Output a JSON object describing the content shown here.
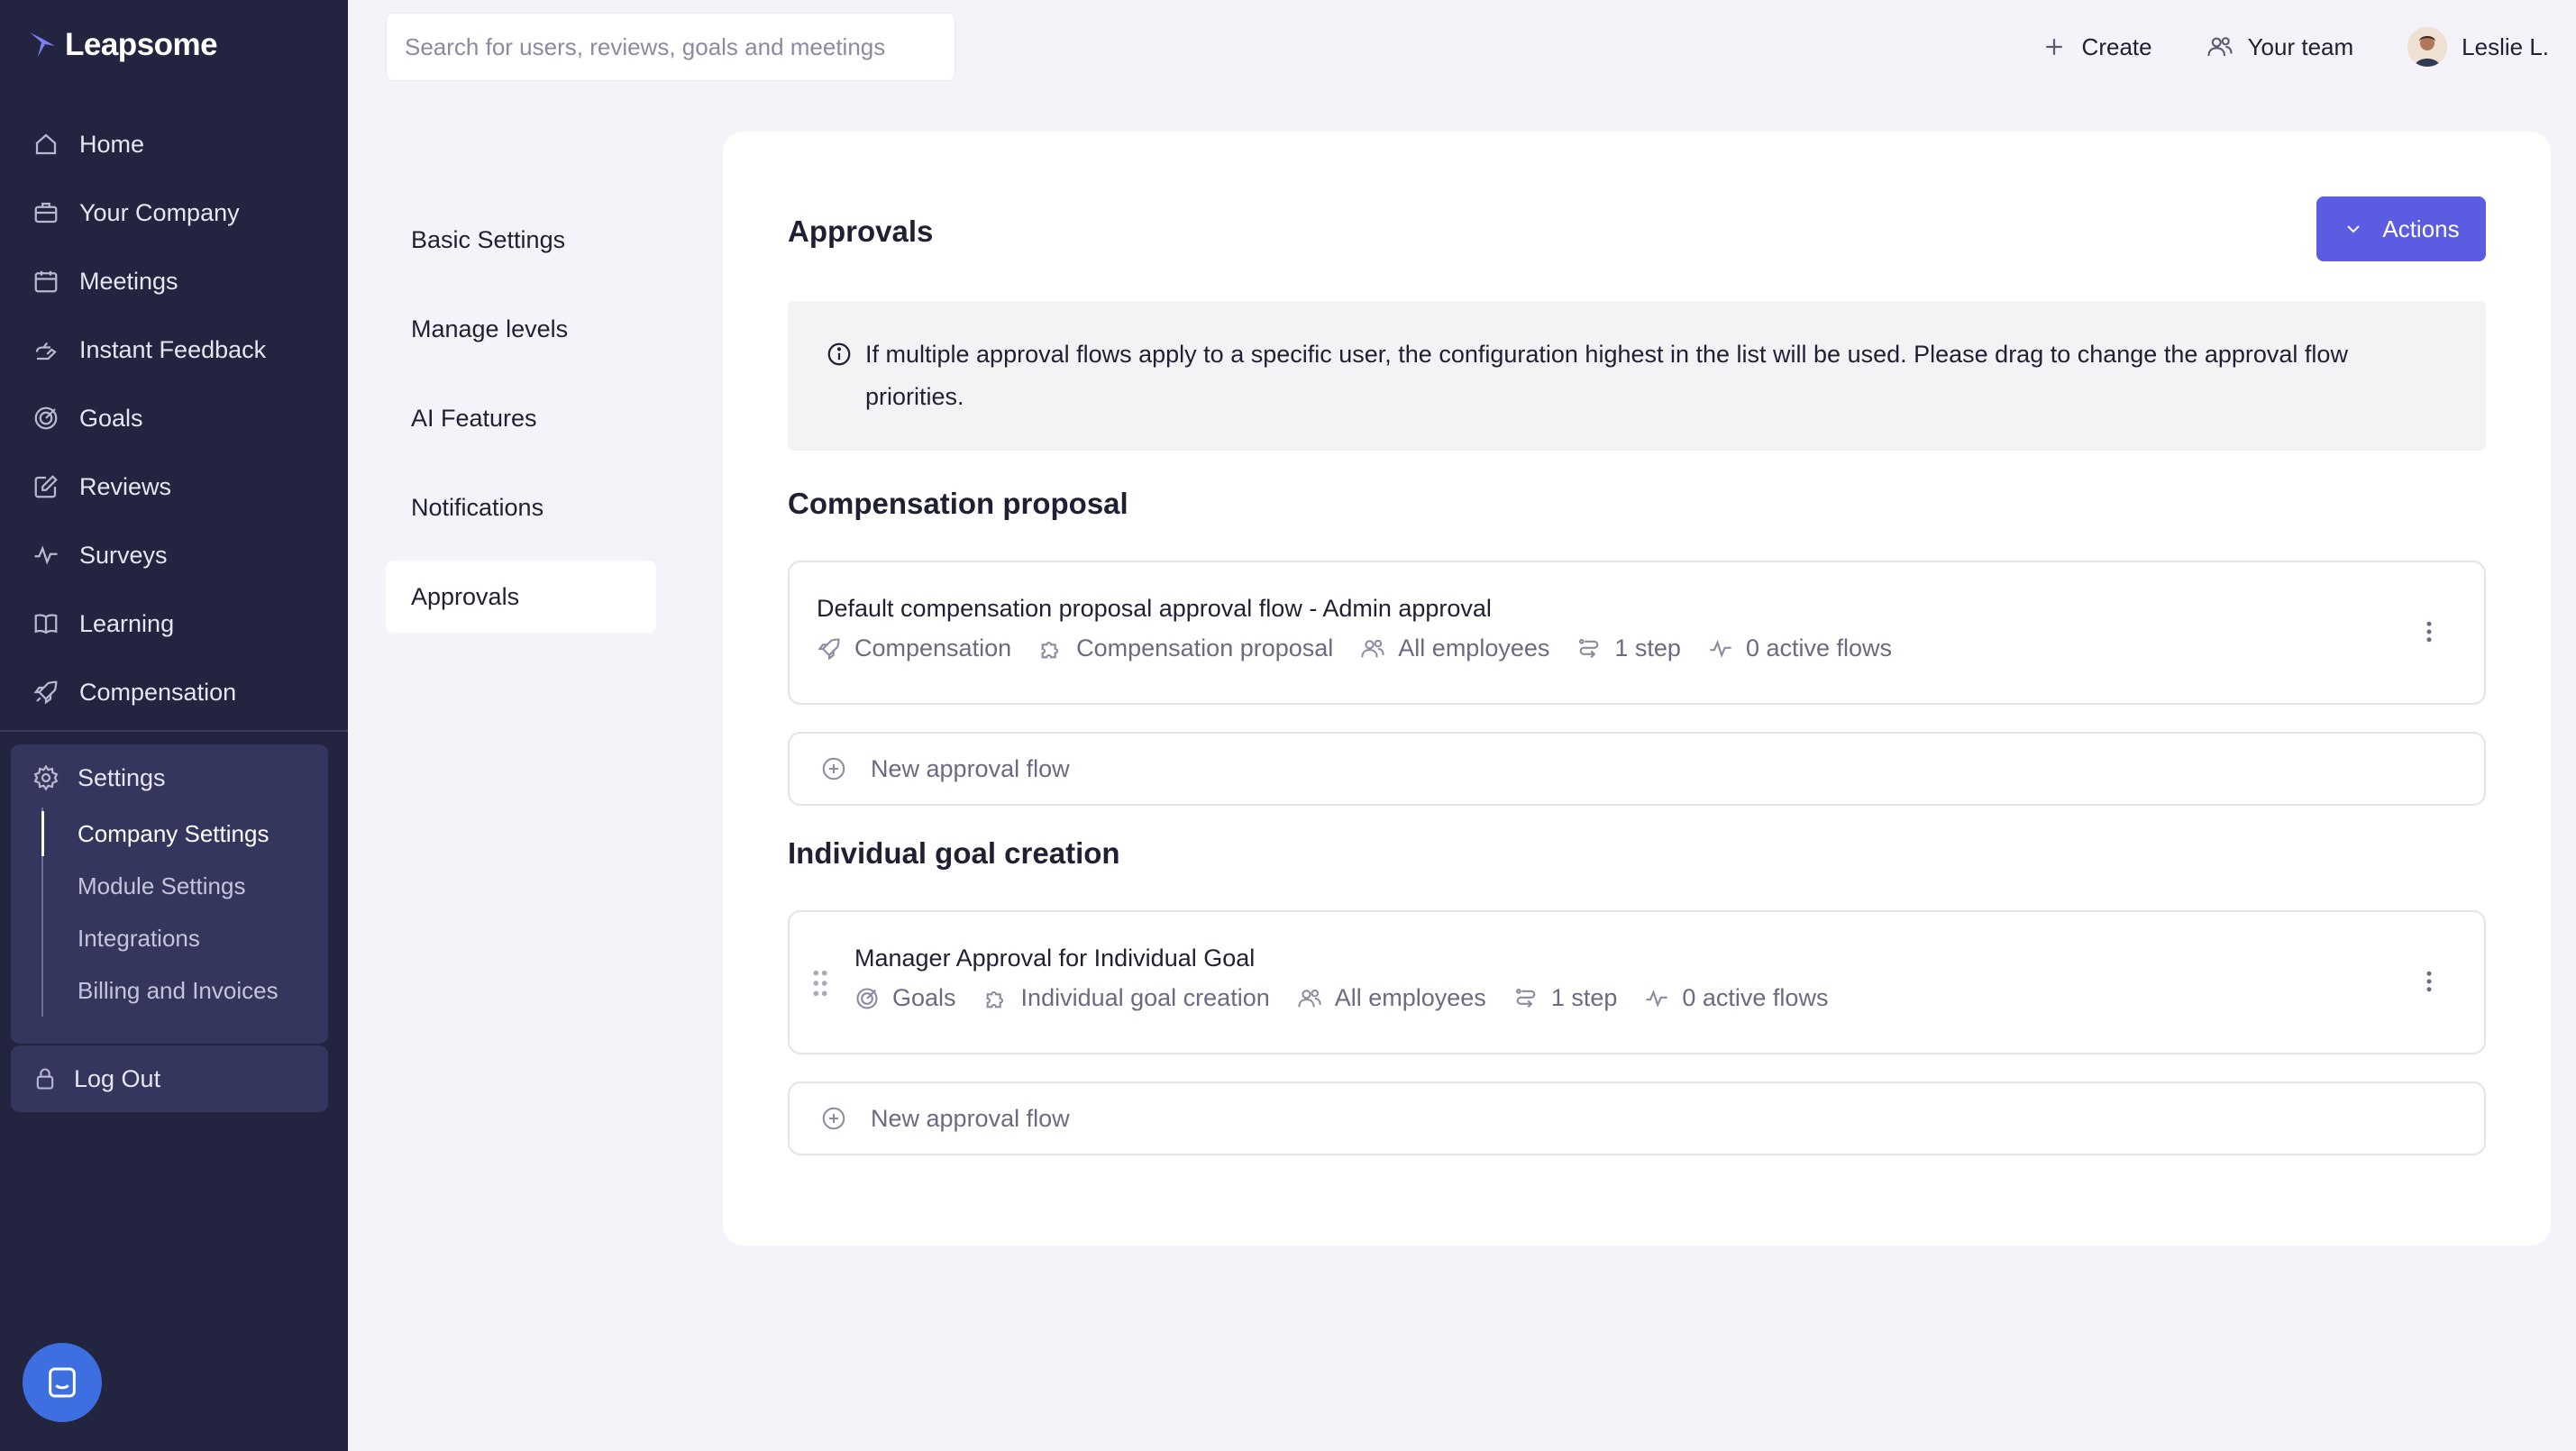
{
  "app": {
    "name": "Leapsome"
  },
  "sidebar": {
    "items": [
      {
        "label": "Home",
        "icon": "home-icon"
      },
      {
        "label": "Your Company",
        "icon": "company-icon"
      },
      {
        "label": "Meetings",
        "icon": "calendar-icon"
      },
      {
        "label": "Instant Feedback",
        "icon": "feedback-icon"
      },
      {
        "label": "Goals",
        "icon": "goals-icon"
      },
      {
        "label": "Reviews",
        "icon": "edit-icon"
      },
      {
        "label": "Surveys",
        "icon": "pulse-icon"
      },
      {
        "label": "Learning",
        "icon": "book-icon"
      },
      {
        "label": "Compensation",
        "icon": "rocket-icon"
      }
    ],
    "settings": {
      "label": "Settings",
      "sub_items": [
        "Company Settings",
        "Module Settings",
        "Integrations",
        "Billing and Invoices"
      ],
      "active": "Company Settings"
    },
    "logout_label": "Log Out"
  },
  "topbar": {
    "search_placeholder": "Search for users, reviews, goals and meetings",
    "create_label": "Create",
    "team_label": "Your team",
    "user_name": "Leslie L."
  },
  "subnav": {
    "items": [
      "Basic Settings",
      "Manage levels",
      "AI Features",
      "Notifications",
      "Approvals"
    ],
    "active": "Approvals"
  },
  "approvals": {
    "title": "Approvals",
    "actions_label": "Actions",
    "info_text": "If multiple approval flows apply to a specific user, the configuration highest in the list will be used. Please drag to change the approval flow priorities.",
    "new_flow_label": "New approval flow",
    "sections": [
      {
        "title": "Compensation proposal",
        "flows": [
          {
            "name": "Default compensation proposal approval flow - Admin approval",
            "module": "Compensation",
            "type": "Compensation proposal",
            "audience": "All employees",
            "steps": "1 step",
            "active": "0 active flows"
          }
        ]
      },
      {
        "title": "Individual goal creation",
        "flows": [
          {
            "name": "Manager Approval for Individual Goal",
            "module": "Goals",
            "type": "Individual goal creation",
            "audience": "All employees",
            "steps": "1 step",
            "active": "0 active flows"
          }
        ]
      }
    ]
  },
  "colors": {
    "sidebar_bg": "#23243f",
    "accent": "#5b5ce2",
    "chat_button": "#3d6fe0",
    "page_bg": "#f3f3f9"
  }
}
